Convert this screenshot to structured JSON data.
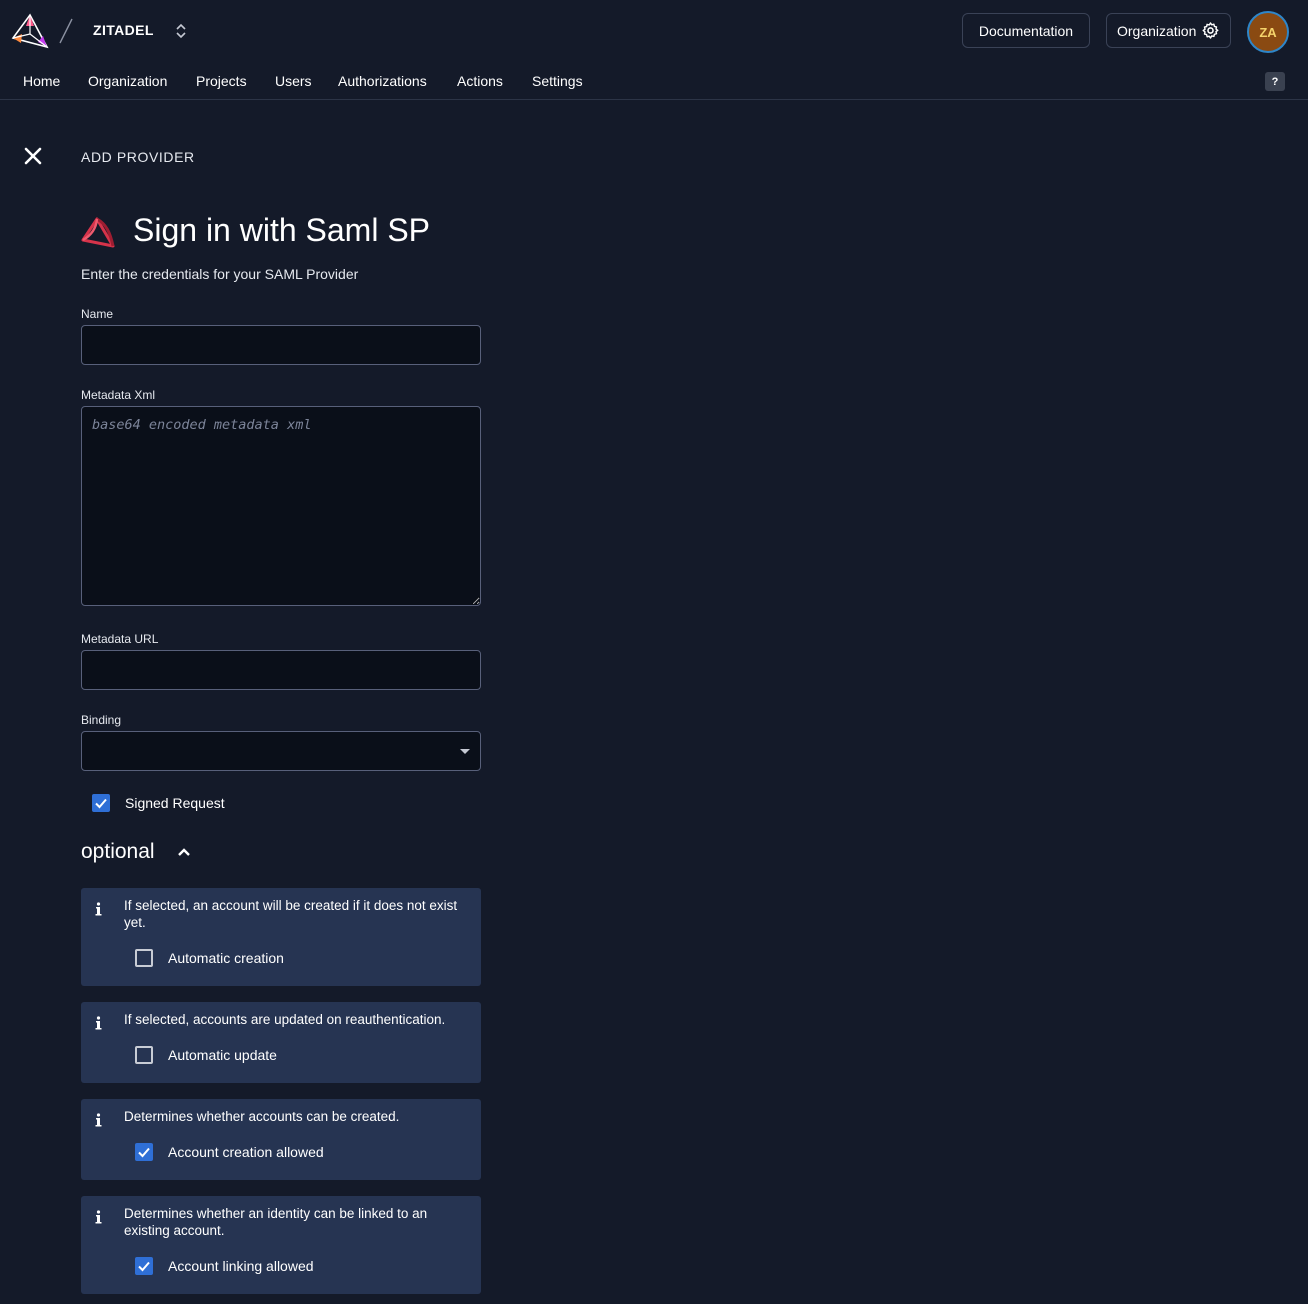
{
  "header": {
    "org_name": "ZITADEL",
    "documentation_label": "Documentation",
    "organization_label": "Organization",
    "avatar_initials": "ZA",
    "help_label": "?"
  },
  "nav": {
    "items": [
      "Home",
      "Organization",
      "Projects",
      "Users",
      "Authorizations",
      "Actions",
      "Settings"
    ]
  },
  "page": {
    "section_label": "ADD PROVIDER",
    "title": "Sign in with Saml SP",
    "subtitle": "Enter the credentials for your SAML Provider"
  },
  "form": {
    "name_label": "Name",
    "name_value": "",
    "metadata_xml_label": "Metadata Xml",
    "metadata_xml_placeholder": "base64 encoded metadata xml",
    "metadata_url_label": "Metadata URL",
    "metadata_url_value": "",
    "binding_label": "Binding",
    "binding_value": "",
    "signed_request_label": "Signed Request",
    "signed_request_checked": true
  },
  "optional": {
    "title": "optional",
    "expanded": true,
    "cards": [
      {
        "info": "If selected, an account will be created if it does not exist yet.",
        "option_label": "Automatic creation",
        "checked": false
      },
      {
        "info": "If selected, accounts are updated on reauthentication.",
        "option_label": "Automatic update",
        "checked": false
      },
      {
        "info": "Determines whether accounts can be created.",
        "option_label": "Account creation allowed",
        "checked": true
      },
      {
        "info": "Determines whether an identity can be linked to an existing account.",
        "option_label": "Account linking allowed",
        "checked": true
      }
    ]
  },
  "colors": {
    "background": "#141a29",
    "card": "#263452",
    "checkbox_checked": "#2f6fd6",
    "brand_red": "#d6334a"
  }
}
